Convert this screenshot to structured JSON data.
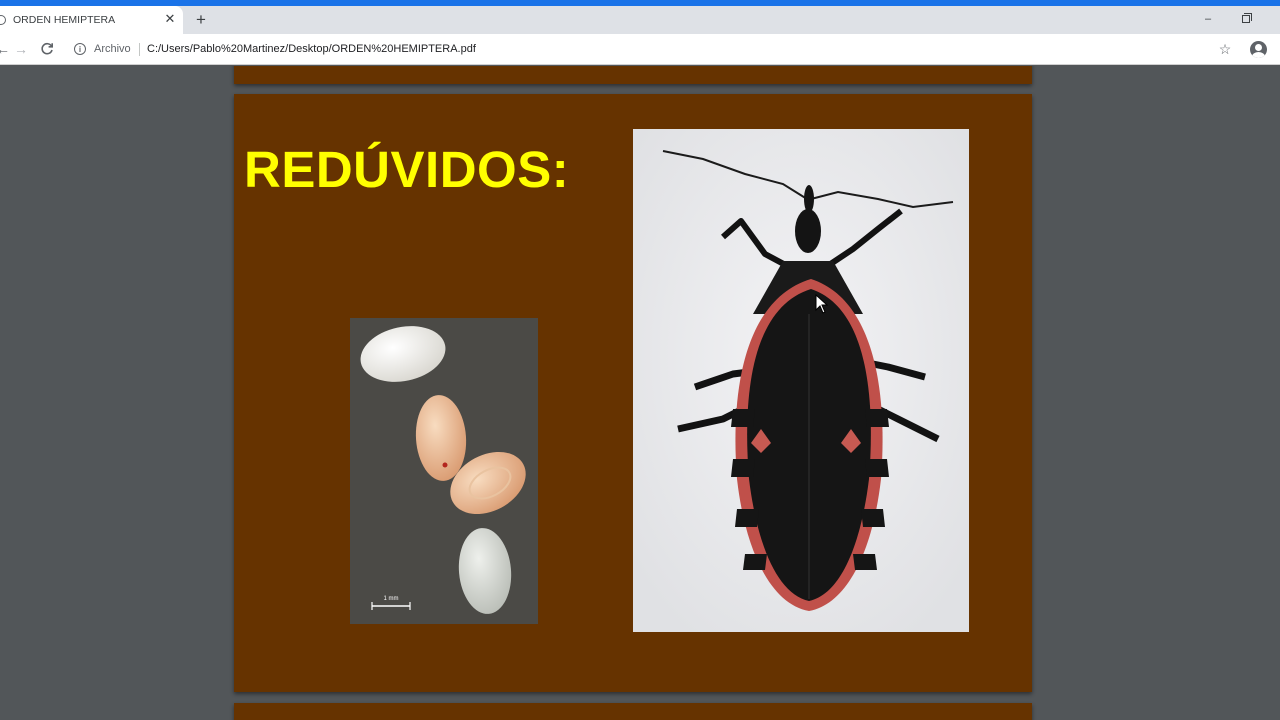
{
  "browser": {
    "tab": {
      "title": "ORDEN HEMIPTERA",
      "close_glyph": "✕"
    },
    "new_tab_glyph": "+",
    "window_controls": {
      "minimize_glyph": "–"
    },
    "address_bar": {
      "scheme_label": "Archivo",
      "url": "C:/Users/Pablo%20Martinez/Desktop/ORDEN%20HEMIPTERA.pdf"
    },
    "icons": {
      "back": "arrow-left-icon",
      "forward": "arrow-right-icon",
      "reload": "reload-icon",
      "info": "info-icon",
      "bookmark": "star-icon",
      "profile": "account-icon"
    }
  },
  "pdf": {
    "slide": {
      "title": "REDÚVIDOS:",
      "scale_bar_label": "1 mm"
    }
  },
  "colors": {
    "page_background": "#663300",
    "title": "#ffff00",
    "viewer_background": "#525659",
    "accent": "#1a73e8"
  }
}
